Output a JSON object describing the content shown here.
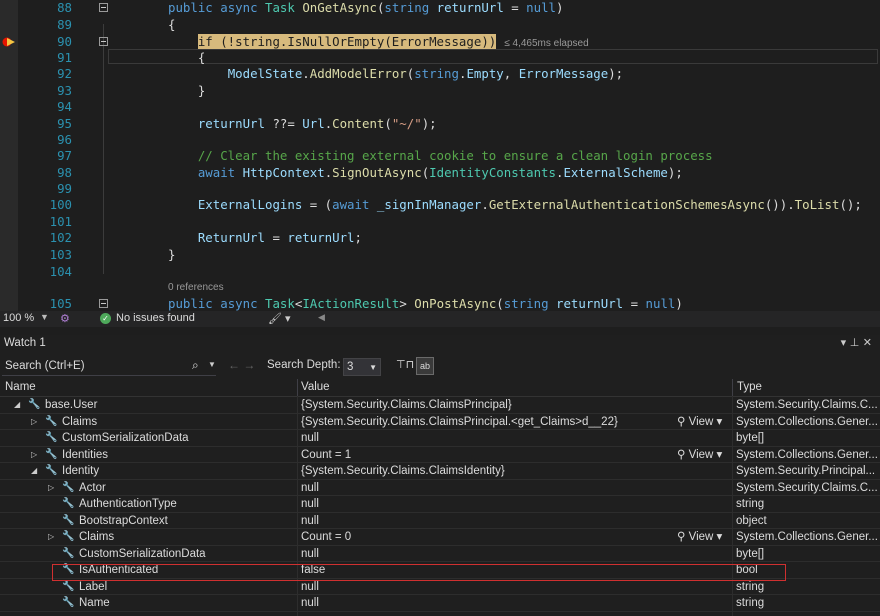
{
  "editor": {
    "lines": [
      {
        "n": "88",
        "fold": true,
        "html": "<span class='k'>public</span> <span class='k'>async</span> <span class='t'>Task</span> <span class='m'>OnGetAsync</span>(<span class='k'>string</span> <span class='p'>returnUrl</span> = <span class='k'>null</span>)"
      },
      {
        "n": "89",
        "fold": false,
        "html": "{"
      },
      {
        "n": "90",
        "fold": true,
        "html": "    <span class='hl'>if (!string.IsNullOrEmpty(ErrorMessage))</span>"
      },
      {
        "n": "91",
        "fold": false,
        "html": "    {"
      },
      {
        "n": "92",
        "fold": false,
        "html": "        <span class='p'>ModelState</span>.<span class='m'>AddModelError</span>(<span class='k'>string</span>.<span class='p'>Empty</span>, <span class='p'>ErrorMessage</span>);"
      },
      {
        "n": "93",
        "fold": false,
        "html": "    }"
      },
      {
        "n": "94",
        "fold": false,
        "html": ""
      },
      {
        "n": "95",
        "fold": false,
        "html": "    <span class='p'>returnUrl</span> ??= <span class='p'>Url</span>.<span class='m'>Content</span>(<span class='s'>\"~/\"</span>);"
      },
      {
        "n": "96",
        "fold": false,
        "html": ""
      },
      {
        "n": "97",
        "fold": false,
        "html": "    <span class='c'>// Clear the existing external cookie to ensure a clean login process</span>"
      },
      {
        "n": "98",
        "fold": false,
        "html": "    <span class='k'>await</span> <span class='p'>HttpContext</span>.<span class='m'>SignOutAsync</span>(<span class='t'>IdentityConstants</span>.<span class='p'>ExternalScheme</span>);"
      },
      {
        "n": "99",
        "fold": false,
        "html": ""
      },
      {
        "n": "100",
        "fold": false,
        "html": "    <span class='p'>ExternalLogins</span> = (<span class='k'>await</span> <span class='p'>_signInManager</span>.<span class='m'>GetExternalAuthenticationSchemesAsync</span>()).<span class='m'>ToList</span>();"
      },
      {
        "n": "101",
        "fold": false,
        "html": ""
      },
      {
        "n": "102",
        "fold": false,
        "html": "    <span class='p'>ReturnUrl</span> = <span class='p'>returnUrl</span>;"
      },
      {
        "n": "103",
        "fold": false,
        "html": "}"
      },
      {
        "n": "104",
        "fold": false,
        "html": ""
      },
      {
        "n": "105",
        "fold": true,
        "html": "<span class='k'>public</span> <span class='k'>async</span> <span class='t'>Task</span>&lt;<span class='t'>IActionResult</span>&gt; <span class='m'>OnPostAsync</span>(<span class='k'>string</span> <span class='p'>returnUrl</span> = <span class='k'>null</span>)"
      }
    ],
    "elapsed": "≤ 4,465ms elapsed",
    "references": "0 references"
  },
  "status": {
    "zoom": "100 %",
    "issues": "No issues found"
  },
  "watch": {
    "title": "Watch 1",
    "search_placeholder": "Search (Ctrl+E)",
    "search_depth_label": "Search Depth:",
    "search_depth_value": "3",
    "col_name": "Name",
    "col_value": "Value",
    "col_type": "Type",
    "view_label": "View",
    "rows": [
      {
        "indent": 0,
        "expander": "open",
        "name": "base.User",
        "value": "{System.Security.Claims.ClaimsPrincipal}",
        "type": "System.Security.Claims.C...",
        "view": false,
        "icon": "wrench-icon"
      },
      {
        "indent": 1,
        "expander": "closed",
        "name": "Claims",
        "value": "{System.Security.Claims.ClaimsPrincipal.<get_Claims>d__22}",
        "type": "System.Collections.Gener...",
        "view": true,
        "icon": "wrench-icon"
      },
      {
        "indent": 1,
        "expander": "none",
        "name": "CustomSerializationData",
        "value": "null",
        "type": "byte[]",
        "view": false,
        "icon": "wrench-star-icon"
      },
      {
        "indent": 1,
        "expander": "closed",
        "name": "Identities",
        "value": "Count = 1",
        "type": "System.Collections.Gener...",
        "view": true,
        "icon": "wrench-icon"
      },
      {
        "indent": 1,
        "expander": "open",
        "name": "Identity",
        "value": "{System.Security.Claims.ClaimsIdentity}",
        "type": "System.Security.Principal...",
        "view": false,
        "icon": "wrench-icon"
      },
      {
        "indent": 2,
        "expander": "closed",
        "name": "Actor",
        "value": "null",
        "type": "System.Security.Claims.C...",
        "view": false,
        "icon": "wrench-icon"
      },
      {
        "indent": 2,
        "expander": "none",
        "name": "AuthenticationType",
        "value": "null",
        "type": "string",
        "view": false,
        "icon": "wrench-icon"
      },
      {
        "indent": 2,
        "expander": "none",
        "name": "BootstrapContext",
        "value": "null",
        "type": "object",
        "view": false,
        "icon": "wrench-icon"
      },
      {
        "indent": 2,
        "expander": "closed",
        "name": "Claims",
        "value": "Count = 0",
        "type": "System.Collections.Gener...",
        "view": true,
        "icon": "wrench-icon"
      },
      {
        "indent": 2,
        "expander": "none",
        "name": "CustomSerializationData",
        "value": "null",
        "type": "byte[]",
        "view": false,
        "icon": "wrench-star-icon"
      },
      {
        "indent": 2,
        "expander": "none",
        "name": "IsAuthenticated",
        "value": "false",
        "type": "bool",
        "view": false,
        "icon": "wrench-icon"
      },
      {
        "indent": 2,
        "expander": "none",
        "name": "Label",
        "value": "null",
        "type": "string",
        "view": false,
        "icon": "wrench-icon"
      },
      {
        "indent": 2,
        "expander": "none",
        "name": "Name",
        "value": "null",
        "type": "string",
        "view": false,
        "icon": "wrench-icon"
      }
    ]
  },
  "colors": {
    "background": "#1e1e1e",
    "keyword": "#569cd6",
    "type": "#4ec9b0",
    "method": "#dcdcaa",
    "identifier": "#9cdcfe",
    "string": "#d69d85",
    "comment": "#57a64a",
    "line_number": "#2b91af",
    "current_statement": "#d7ba7d",
    "highlight_box": "#d03030"
  }
}
